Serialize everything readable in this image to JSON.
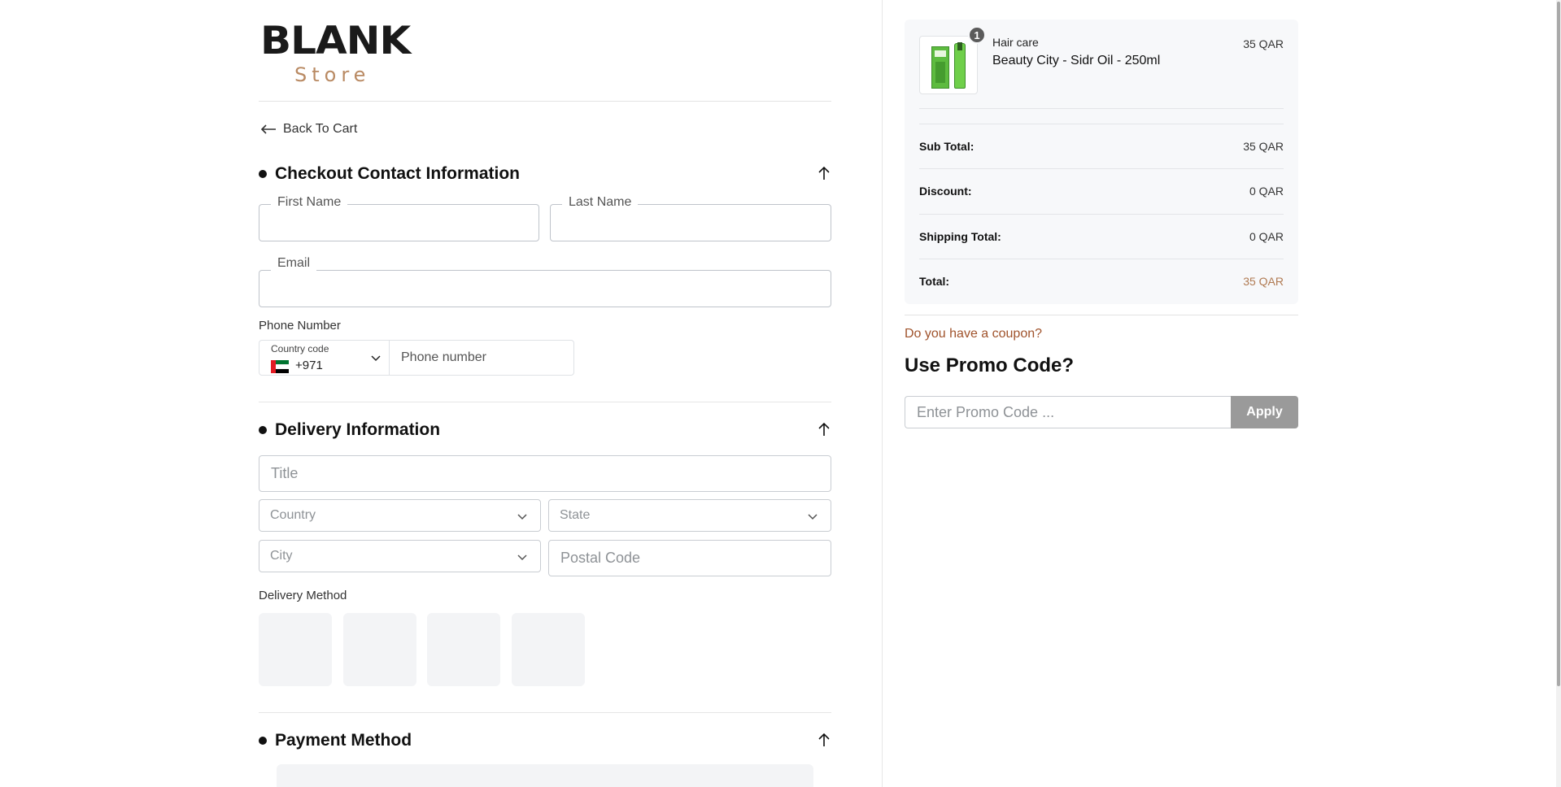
{
  "brand": {
    "wordmark": "BLANK",
    "subtitle": "Store"
  },
  "back_link": "Back To Cart",
  "contact": {
    "title": "Checkout Contact Information",
    "first_name_label": "First Name",
    "last_name_label": "Last Name",
    "email_label": "Email",
    "phone_label": "Phone Number",
    "country_code_caption": "Country code",
    "country_code_value": "+971",
    "phone_placeholder": "Phone number"
  },
  "delivery": {
    "title": "Delivery Information",
    "title_placeholder": "Title",
    "country_placeholder": "Country",
    "state_placeholder": "State",
    "city_placeholder": "City",
    "postal_placeholder": "Postal Code",
    "method_label": "Delivery Method"
  },
  "payment": {
    "title": "Payment Method"
  },
  "order": {
    "item": {
      "quantity": "1",
      "category": "Hair care",
      "name": "Beauty City - Sidr Oil - 250ml",
      "price": "35 QAR"
    },
    "rows": [
      {
        "label": "Sub Total:",
        "value": "35 QAR"
      },
      {
        "label": "Discount:",
        "value": "0 QAR"
      },
      {
        "label": "Shipping Total:",
        "value": "0 QAR"
      },
      {
        "label": "Total:",
        "value": "35 QAR"
      }
    ]
  },
  "promo": {
    "question": "Do you have a coupon?",
    "title": "Use Promo Code?",
    "placeholder": "Enter Promo Code ...",
    "apply_label": "Apply"
  },
  "colors": {
    "accent": "#b07a52",
    "coupon_link": "#a0532c",
    "apply_button": "#9a9a9a",
    "panel_bg": "#f7f8fa"
  },
  "icons": {
    "back": "arrow-left-icon",
    "collapse": "arrow-up-icon",
    "dropdown": "chevron-down-icon",
    "flag": "uae-flag-icon"
  }
}
